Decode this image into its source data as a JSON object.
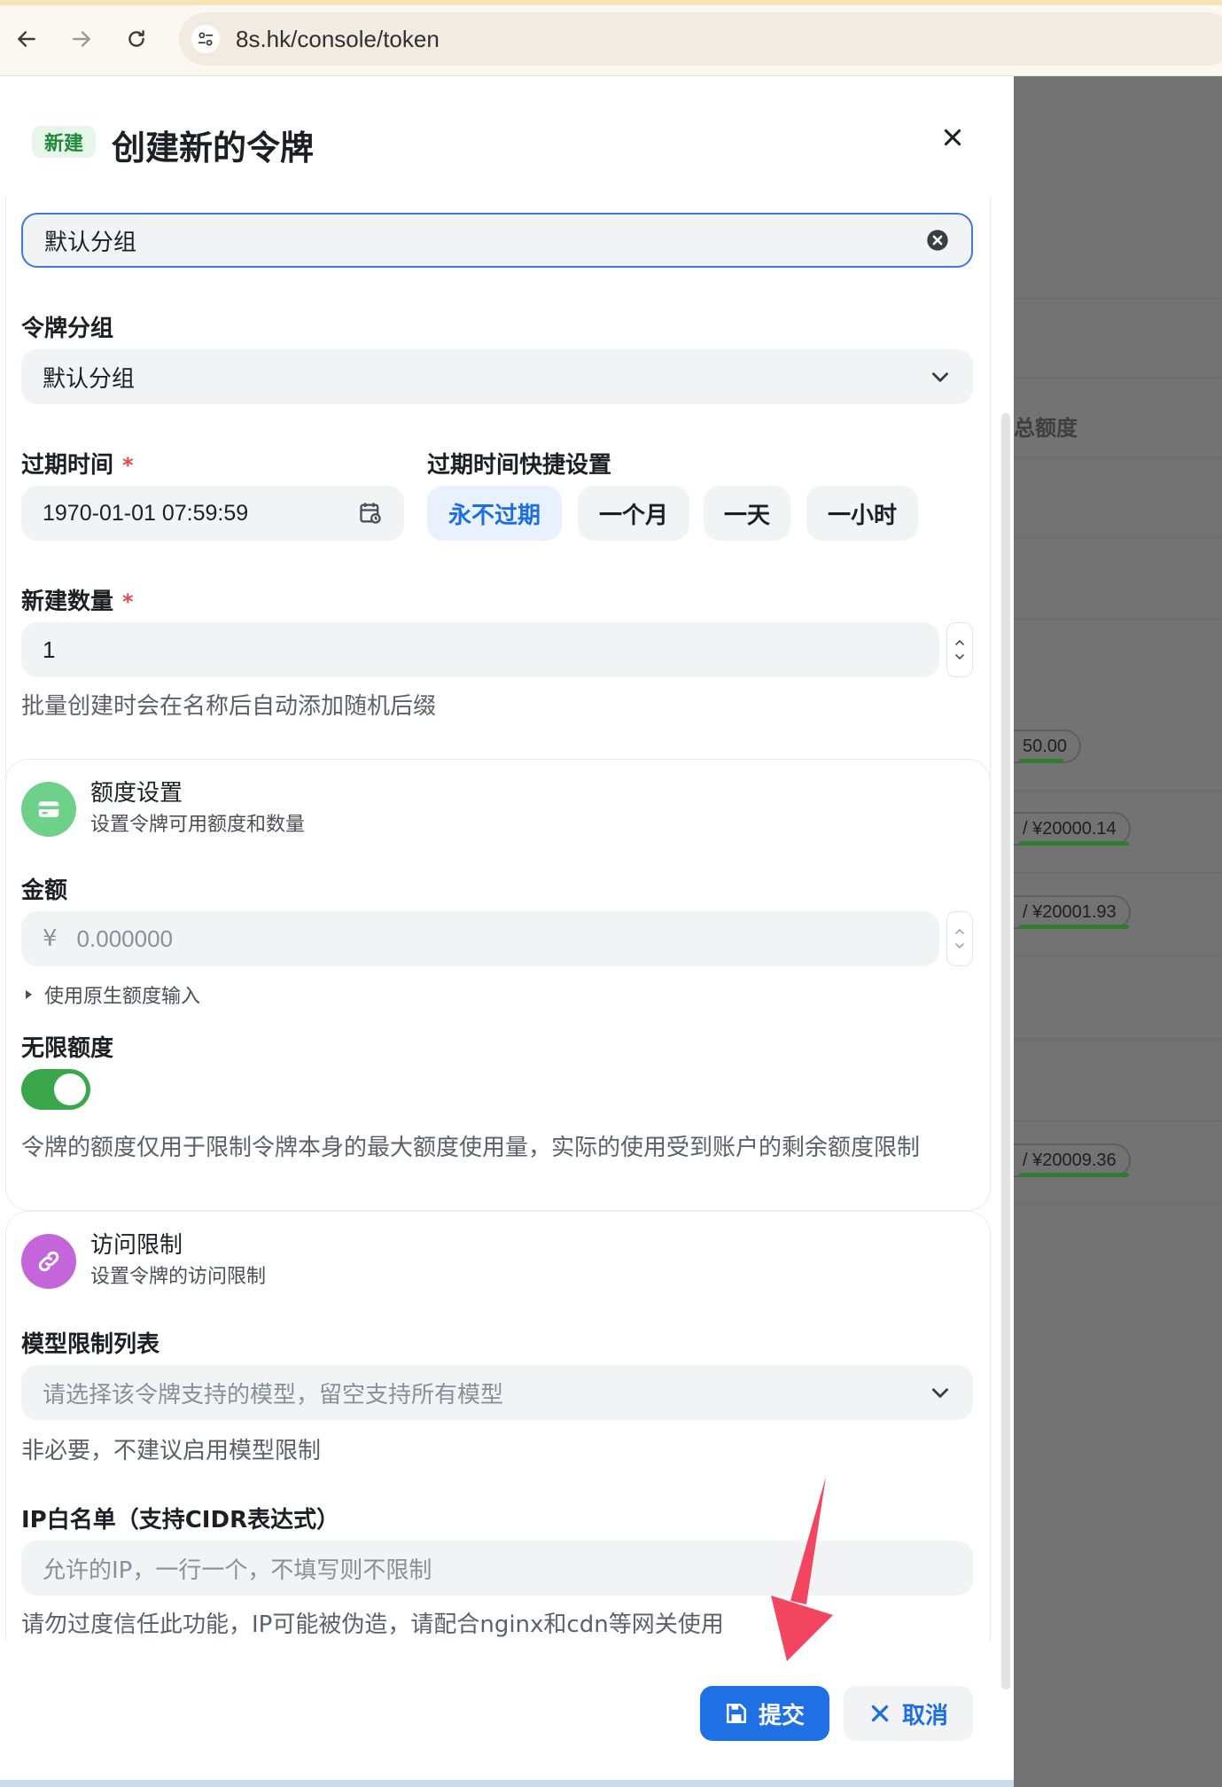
{
  "browser": {
    "url": "8s.hk/console/token"
  },
  "sheet": {
    "badge": "新建",
    "title": "创建新的令牌"
  },
  "basic": {
    "name_value": "默认分组",
    "group_label": "令牌分组",
    "group_value": "默认分组",
    "expire_label": "过期时间",
    "expire_value": "1970-01-01 07:59:59",
    "quick_label": "过期时间快捷设置",
    "quick_options": [
      "永不过期",
      "一个月",
      "一天",
      "一小时"
    ],
    "count_label": "新建数量",
    "count_value": "1",
    "count_hint": "批量创建时会在名称后自动添加随机后缀",
    "required_mark": "*"
  },
  "quota": {
    "title": "额度设置",
    "subtitle": "设置令牌可用额度和数量",
    "amount_label": "金额",
    "currency": "¥",
    "amount_placeholder": "0.000000",
    "raw_toggle": "使用原生额度输入",
    "unlimited_label": "无限额度",
    "unlimited_on": true,
    "note": "令牌的额度仅用于限制令牌本身的最大额度使用量，实际的使用受到账户的剩余额度限制"
  },
  "access": {
    "title": "访问限制",
    "subtitle": "设置令牌的访问限制",
    "model_label": "模型限制列表",
    "model_placeholder": "请选择该令牌支持的模型，留空支持所有模型",
    "model_hint": "非必要，不建议启用模型限制",
    "ip_label": "IP白名单（支持CIDR表达式）",
    "ip_placeholder": "允许的IP，一行一个，不填写则不限制",
    "ip_hint": "请勿过度信任此功能，IP可能被伪造，请配合nginx和cdn等网关使用"
  },
  "footer": {
    "submit": "提交",
    "cancel": "取消"
  },
  "background": {
    "column_header": "总额度",
    "pills": [
      "50.00",
      "/ ¥20000.14",
      "/ ¥20001.93",
      "/ ¥20009.36"
    ]
  },
  "colors": {
    "primary": "#1f6fe5",
    "success_toggle": "#3aa84a",
    "quota_icon_bg": "#6dd18a",
    "access_icon_bg": "#c465d9",
    "required": "#e5484d"
  }
}
